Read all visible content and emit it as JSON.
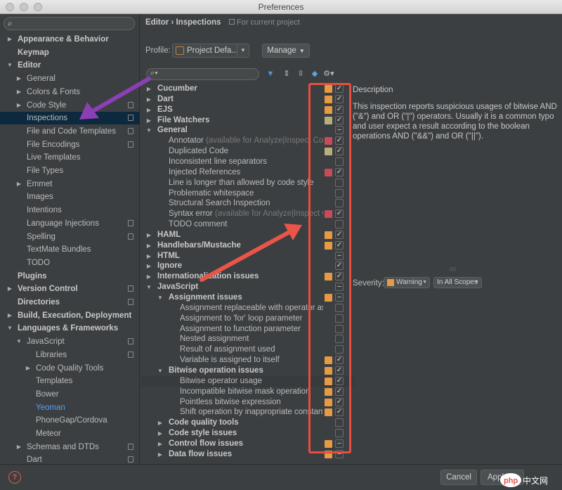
{
  "window": {
    "title": "Preferences"
  },
  "sidebar": {
    "search_placeholder": "",
    "items": [
      {
        "label": "Appearance & Behavior",
        "level": 0,
        "bold": true,
        "arrow": "right"
      },
      {
        "label": "Keymap",
        "level": 0,
        "bold": true,
        "arrow": ""
      },
      {
        "label": "Editor",
        "level": 0,
        "bold": true,
        "arrow": "down"
      },
      {
        "label": "General",
        "level": 1,
        "arrow": "right"
      },
      {
        "label": "Colors & Fonts",
        "level": 1,
        "arrow": "right"
      },
      {
        "label": "Code Style",
        "level": 1,
        "arrow": "right",
        "copy": true
      },
      {
        "label": "Inspections",
        "level": 1,
        "arrow": "",
        "copy": true,
        "selected": true
      },
      {
        "label": "File and Code Templates",
        "level": 1,
        "arrow": "",
        "copy": true
      },
      {
        "label": "File Encodings",
        "level": 1,
        "arrow": "",
        "copy": true
      },
      {
        "label": "Live Templates",
        "level": 1,
        "arrow": ""
      },
      {
        "label": "File Types",
        "level": 1,
        "arrow": ""
      },
      {
        "label": "Emmet",
        "level": 1,
        "arrow": "right"
      },
      {
        "label": "Images",
        "level": 1,
        "arrow": ""
      },
      {
        "label": "Intentions",
        "level": 1,
        "arrow": ""
      },
      {
        "label": "Language Injections",
        "level": 1,
        "arrow": "",
        "copy": true
      },
      {
        "label": "Spelling",
        "level": 1,
        "arrow": "",
        "copy": true
      },
      {
        "label": "TextMate Bundles",
        "level": 1,
        "arrow": ""
      },
      {
        "label": "TODO",
        "level": 1,
        "arrow": ""
      },
      {
        "label": "Plugins",
        "level": 0,
        "bold": true,
        "arrow": ""
      },
      {
        "label": "Version Control",
        "level": 0,
        "bold": true,
        "arrow": "right",
        "copy": true
      },
      {
        "label": "Directories",
        "level": 0,
        "bold": true,
        "arrow": "",
        "copy": true
      },
      {
        "label": "Build, Execution, Deployment",
        "level": 0,
        "bold": true,
        "arrow": "right"
      },
      {
        "label": "Languages & Frameworks",
        "level": 0,
        "bold": true,
        "arrow": "down"
      },
      {
        "label": "JavaScript",
        "level": 1,
        "arrow": "down",
        "copy": true
      },
      {
        "label": "Libraries",
        "level": 2,
        "arrow": "",
        "copy": true
      },
      {
        "label": "Code Quality Tools",
        "level": 2,
        "arrow": "right"
      },
      {
        "label": "Templates",
        "level": 2,
        "arrow": ""
      },
      {
        "label": "Bower",
        "level": 2,
        "arrow": ""
      },
      {
        "label": "Yeoman",
        "level": 2,
        "arrow": "",
        "active": true
      },
      {
        "label": "PhoneGap/Cordova",
        "level": 2,
        "arrow": ""
      },
      {
        "label": "Meteor",
        "level": 2,
        "arrow": ""
      },
      {
        "label": "Schemas and DTDs",
        "level": 1,
        "arrow": "right",
        "copy": true
      },
      {
        "label": "Dart",
        "level": 1,
        "arrow": "",
        "copy": true
      }
    ]
  },
  "header": {
    "crumb_editor": "Editor",
    "crumb_sep": "›",
    "crumb_inspections": "Inspections",
    "crumb_note": "For current project"
  },
  "profile": {
    "label": "Profile:",
    "value": "Project Defa...",
    "manage_label": "Manage"
  },
  "filter": {
    "placeholder": ""
  },
  "inspections": [
    {
      "label": "Cucumber",
      "level": 0,
      "bold": true,
      "arrow": "right",
      "sev": "#e59a44",
      "check": "checked"
    },
    {
      "label": "Dart",
      "level": 0,
      "bold": true,
      "arrow": "right",
      "sev": "#e59a44",
      "check": "checked"
    },
    {
      "label": "EJS",
      "level": 0,
      "bold": true,
      "arrow": "right",
      "sev": "#e59a44",
      "check": "checked"
    },
    {
      "label": "File Watchers",
      "level": 0,
      "bold": true,
      "arrow": "right",
      "sev": "#b5b07a",
      "check": "checked"
    },
    {
      "label": "General",
      "level": 0,
      "bold": true,
      "arrow": "down",
      "sev": "",
      "check": "partial"
    },
    {
      "label": "Annotator",
      "note": " (available for Analyze|Inspect Code)",
      "level": 1,
      "sev": "#c94a5a",
      "check": "checked"
    },
    {
      "label": "Duplicated Code",
      "level": 1,
      "sev": "#b5b07a",
      "check": "checked"
    },
    {
      "label": "Inconsistent line separators",
      "level": 1,
      "sev": "",
      "check": "empty"
    },
    {
      "label": "Injected References",
      "level": 1,
      "sev": "#c94a5a",
      "check": "checked"
    },
    {
      "label": "Line is longer than allowed by code style",
      "level": 1,
      "sev": "",
      "check": "empty"
    },
    {
      "label": "Problematic whitespace",
      "level": 1,
      "sev": "",
      "check": "empty"
    },
    {
      "label": "Structural Search Inspection",
      "level": 1,
      "sev": "",
      "check": "empty"
    },
    {
      "label": "Syntax error",
      "note": " (available for Analyze|Inspect Code)",
      "level": 1,
      "sev": "#c94a5a",
      "check": "checked"
    },
    {
      "label": "TODO comment",
      "level": 1,
      "sev": "",
      "check": "empty"
    },
    {
      "label": "HAML",
      "level": 0,
      "bold": true,
      "arrow": "right",
      "sev": "#e59a44",
      "check": "checked"
    },
    {
      "label": "Handlebars/Mustache",
      "level": 0,
      "bold": true,
      "arrow": "right",
      "sev": "#e59a44",
      "check": "checked"
    },
    {
      "label": "HTML",
      "level": 0,
      "bold": true,
      "arrow": "right",
      "sev": "",
      "check": "partial"
    },
    {
      "label": "Ignore",
      "level": 0,
      "bold": true,
      "arrow": "right",
      "sev": "",
      "check": "checked"
    },
    {
      "label": "Internationalization issues",
      "level": 0,
      "bold": true,
      "arrow": "right",
      "sev": "#e59a44",
      "check": "checked"
    },
    {
      "label": "JavaScript",
      "level": 0,
      "bold": true,
      "arrow": "down",
      "sev": "",
      "check": "partial"
    },
    {
      "label": "Assignment issues",
      "level": 1,
      "bold": true,
      "arrow": "down",
      "sev": "#e59a44",
      "check": "partial"
    },
    {
      "label": "Assignment replaceable with operator assignment",
      "level": 2,
      "sev": "",
      "check": "empty"
    },
    {
      "label": "Assignment to 'for' loop parameter",
      "level": 2,
      "sev": "",
      "check": "empty"
    },
    {
      "label": "Assignment to function parameter",
      "level": 2,
      "sev": "",
      "check": "empty"
    },
    {
      "label": "Nested assignment",
      "level": 2,
      "sev": "",
      "check": "empty"
    },
    {
      "label": "Result of assignment used",
      "level": 2,
      "sev": "",
      "check": "empty"
    },
    {
      "label": "Variable is assigned to itself",
      "level": 2,
      "sev": "#e59a44",
      "check": "checked"
    },
    {
      "label": "Bitwise operation issues",
      "level": 1,
      "bold": true,
      "arrow": "down",
      "sev": "#e59a44",
      "check": "checked"
    },
    {
      "label": "Bitwise operator usage",
      "level": 2,
      "sev": "#e59a44",
      "check": "checked",
      "selected": true
    },
    {
      "label": "Incompatible bitwise mask operation",
      "level": 2,
      "sev": "#e59a44",
      "check": "checked"
    },
    {
      "label": "Pointless bitwise expression",
      "level": 2,
      "sev": "#e59a44",
      "check": "checked"
    },
    {
      "label": "Shift operation by inappropriate constant",
      "level": 2,
      "sev": "#e59a44",
      "check": "checked"
    },
    {
      "label": "Code quality tools",
      "level": 1,
      "bold": true,
      "arrow": "right",
      "sev": "",
      "check": "empty"
    },
    {
      "label": "Code style issues",
      "level": 1,
      "bold": true,
      "arrow": "right",
      "sev": "",
      "check": "empty"
    },
    {
      "label": "Control flow issues",
      "level": 1,
      "bold": true,
      "arrow": "right",
      "sev": "#e59a44",
      "check": "partial"
    },
    {
      "label": "Data flow issues",
      "level": 1,
      "bold": true,
      "arrow": "right",
      "sev": "#e59a44",
      "check": "partial"
    }
  ],
  "description": {
    "title": "Description",
    "text": "This inspection reports suspicious usages of bitwise AND (\"&\") and OR (\"|\") operators. Usually it is a common typo and user expect a result according to the boolean operations AND (\"&&\") and OR (\"||\")."
  },
  "severity": {
    "label": "Severity:",
    "value": "Warning",
    "color": "#e59a44",
    "scope": "In All Scopes"
  },
  "footer": {
    "help": "?",
    "cancel_label": "Cancel",
    "apply_label": "Apply"
  },
  "watermark": {
    "text": "php 中文网"
  },
  "colors": {
    "highlight": "#e94d3f",
    "purple_arrow": "#8b3fb5",
    "red_arrow": "#ec5448"
  }
}
